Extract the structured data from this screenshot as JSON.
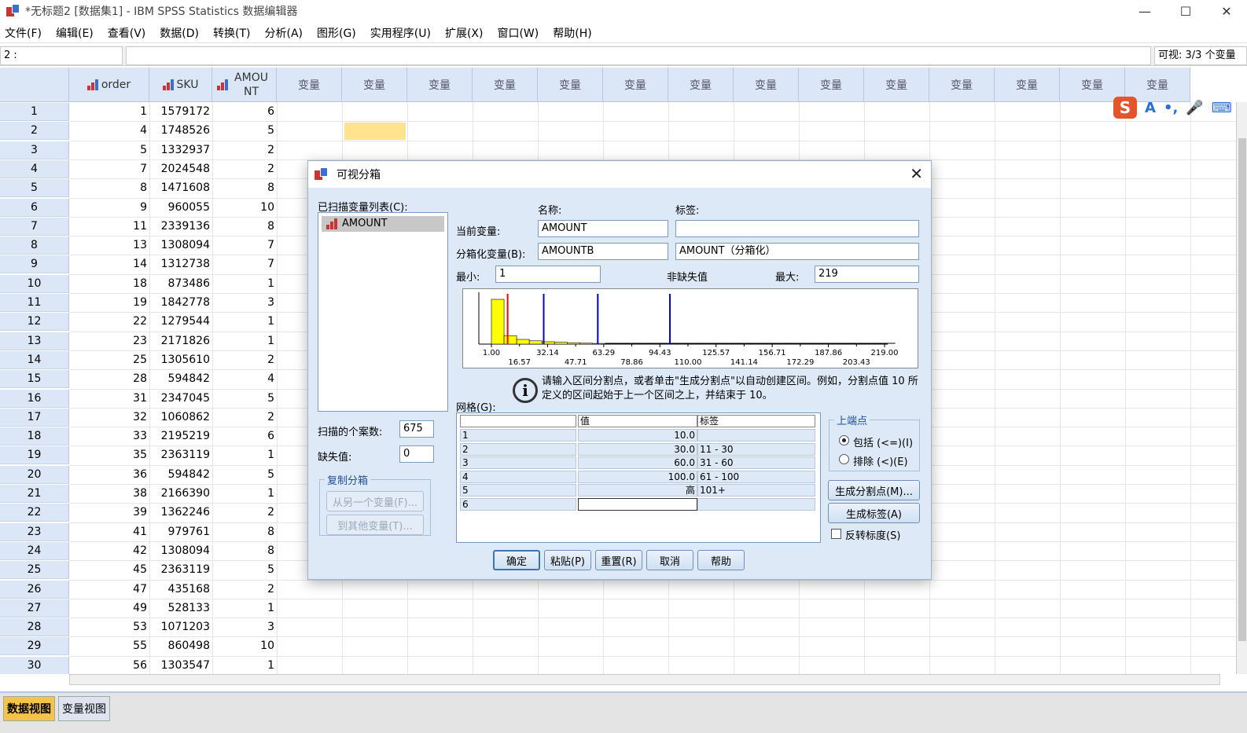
{
  "window": {
    "title": "*无标题2 [数据集1] - IBM SPSS Statistics 数据编辑器",
    "minimize": "—",
    "maximize": "☐",
    "close": "✕"
  },
  "menu": [
    "文件(F)",
    "编辑(E)",
    "查看(V)",
    "数据(D)",
    "转换(T)",
    "分析(A)",
    "图形(G)",
    "实用程序(U)",
    "扩展(X)",
    "窗口(W)",
    "帮助(H)"
  ],
  "cell_ref": "2 :",
  "visible_vars": "可视: 3/3 个变量",
  "columns": {
    "order": "order",
    "sku": "SKU",
    "amount": "AMOUNT",
    "placeholder": "变量",
    "placeholder_count": 14
  },
  "rows": [
    {
      "n": "1",
      "order": "1",
      "sku": "1579172",
      "amount": "6"
    },
    {
      "n": "2",
      "order": "4",
      "sku": "1748526",
      "amount": "5"
    },
    {
      "n": "3",
      "order": "5",
      "sku": "1332937",
      "amount": "2"
    },
    {
      "n": "4",
      "order": "7",
      "sku": "2024548",
      "amount": "2"
    },
    {
      "n": "5",
      "order": "8",
      "sku": "1471608",
      "amount": "8"
    },
    {
      "n": "6",
      "order": "9",
      "sku": "960055",
      "amount": "10"
    },
    {
      "n": "7",
      "order": "11",
      "sku": "2339136",
      "amount": "8"
    },
    {
      "n": "8",
      "order": "13",
      "sku": "1308094",
      "amount": "7"
    },
    {
      "n": "9",
      "order": "14",
      "sku": "1312738",
      "amount": "7"
    },
    {
      "n": "10",
      "order": "18",
      "sku": "873486",
      "amount": "1"
    },
    {
      "n": "11",
      "order": "19",
      "sku": "1842778",
      "amount": "3"
    },
    {
      "n": "12",
      "order": "22",
      "sku": "1279544",
      "amount": "1"
    },
    {
      "n": "13",
      "order": "23",
      "sku": "2171826",
      "amount": "1"
    },
    {
      "n": "14",
      "order": "25",
      "sku": "1305610",
      "amount": "2"
    },
    {
      "n": "15",
      "order": "28",
      "sku": "594842",
      "amount": "4"
    },
    {
      "n": "16",
      "order": "31",
      "sku": "2347045",
      "amount": "5"
    },
    {
      "n": "17",
      "order": "32",
      "sku": "1060862",
      "amount": "2"
    },
    {
      "n": "18",
      "order": "33",
      "sku": "2195219",
      "amount": "6"
    },
    {
      "n": "19",
      "order": "35",
      "sku": "2363119",
      "amount": "1"
    },
    {
      "n": "20",
      "order": "36",
      "sku": "594842",
      "amount": "5"
    },
    {
      "n": "21",
      "order": "38",
      "sku": "2166390",
      "amount": "1"
    },
    {
      "n": "22",
      "order": "39",
      "sku": "1362246",
      "amount": "2"
    },
    {
      "n": "23",
      "order": "41",
      "sku": "979761",
      "amount": "8"
    },
    {
      "n": "24",
      "order": "42",
      "sku": "1308094",
      "amount": "8"
    },
    {
      "n": "25",
      "order": "45",
      "sku": "2363119",
      "amount": "5"
    },
    {
      "n": "26",
      "order": "47",
      "sku": "435168",
      "amount": "2"
    },
    {
      "n": "27",
      "order": "49",
      "sku": "528133",
      "amount": "1"
    },
    {
      "n": "28",
      "order": "53",
      "sku": "1071203",
      "amount": "3"
    },
    {
      "n": "29",
      "order": "55",
      "sku": "860498",
      "amount": "10"
    },
    {
      "n": "30",
      "order": "56",
      "sku": "1303547",
      "amount": "1"
    }
  ],
  "tabs": {
    "data_view": "数据视图",
    "variable_view": "变量视图"
  },
  "dialog": {
    "title": "可视分箱",
    "close": "✕",
    "scanned_list_label": "已扫描变量列表(C):",
    "scanned_item": "AMOUNT",
    "name_header": "名称:",
    "label_header": "标签:",
    "current_var_label": "当前变量:",
    "current_var_name": "AMOUNT",
    "current_var_label_value": "",
    "binned_var_label": "分箱化变量(B):",
    "binned_var_name": "AMOUNTB",
    "binned_var_label_value": "AMOUNT（分箱化）",
    "min_label": "最小:",
    "min_value": "1",
    "nonmissing_label": "非缺失值",
    "max_label": "最大:",
    "max_value": "219",
    "cases_scanned_label": "扫描的个案数:",
    "cases_scanned_value": "675",
    "missing_label": "缺失值:",
    "missing_value": "0",
    "copy_bins_group": "复制分箱",
    "from_other_btn": "从另一个变量(F)...",
    "to_other_btn": "到其他变量(T)...",
    "info_text_1": "请输入区间分割点，或者单击\"生成分割点\"以自动创建区间。例如，分割点值 10 所",
    "info_text_2": "定义的区间起始于上一个区间之上，并结束于 10。",
    "grid_label": "网格(G):",
    "grid_header_value": "值",
    "grid_header_label": "标签",
    "grid_rows": [
      {
        "idx": "1",
        "value": "10.0",
        "label": ""
      },
      {
        "idx": "2",
        "value": "30.0",
        "label": "11 - 30"
      },
      {
        "idx": "3",
        "value": "60.0",
        "label": "31 - 60"
      },
      {
        "idx": "4",
        "value": "100.0",
        "label": "61 - 100"
      },
      {
        "idx": "5",
        "value": "高",
        "label": "101+"
      },
      {
        "idx": "6",
        "value": "",
        "label": ""
      }
    ],
    "upper_endpoint_group": "上端点",
    "include_label": "包括 (<=)(I)",
    "exclude_label": "排除 (<)(E)",
    "gen_cutpoints_btn": "生成分割点(M)...",
    "gen_labels_btn": "生成标签(A)",
    "reverse_scale_label": "反转标度(S)",
    "ok_btn": "确定",
    "paste_btn": "粘贴(P)",
    "reset_btn": "重置(R)",
    "cancel_btn": "取消",
    "help_btn": "帮助"
  },
  "histogram": {
    "xmin": 1,
    "xmax": 219,
    "tick_labels_top": [
      "1.00",
      "32.14",
      "63.29",
      "94.43",
      "125.57",
      "156.71",
      "187.86",
      "219.00"
    ],
    "tick_labels_bottom": [
      "16.57",
      "47.71",
      "78.86",
      "110.00",
      "141.14",
      "172.29",
      "203.43"
    ],
    "ticks_top": [
      1.0,
      32.14,
      63.29,
      94.43,
      125.57,
      156.71,
      187.86,
      219.0
    ],
    "ticks_bottom": [
      16.57,
      47.71,
      78.86,
      110.0,
      141.14,
      172.29,
      203.43
    ],
    "bars": [
      {
        "from": 1,
        "to": 8,
        "height": 0.95
      },
      {
        "from": 8,
        "to": 15,
        "height": 0.18
      },
      {
        "from": 15,
        "to": 22,
        "height": 0.1
      },
      {
        "from": 22,
        "to": 29,
        "height": 0.07
      },
      {
        "from": 29,
        "to": 36,
        "height": 0.05
      },
      {
        "from": 36,
        "to": 43,
        "height": 0.04
      },
      {
        "from": 43,
        "to": 50,
        "height": 0.03
      },
      {
        "from": 50,
        "to": 57,
        "height": 0.02
      },
      {
        "from": 57,
        "to": 64,
        "height": 0.015
      }
    ],
    "cutpoint_red": 10,
    "cutpoints_blue": [
      30,
      60,
      100
    ],
    "bar_color": "#ffff00",
    "red_color": "#ff0000",
    "blue_color": "#0000cc"
  }
}
